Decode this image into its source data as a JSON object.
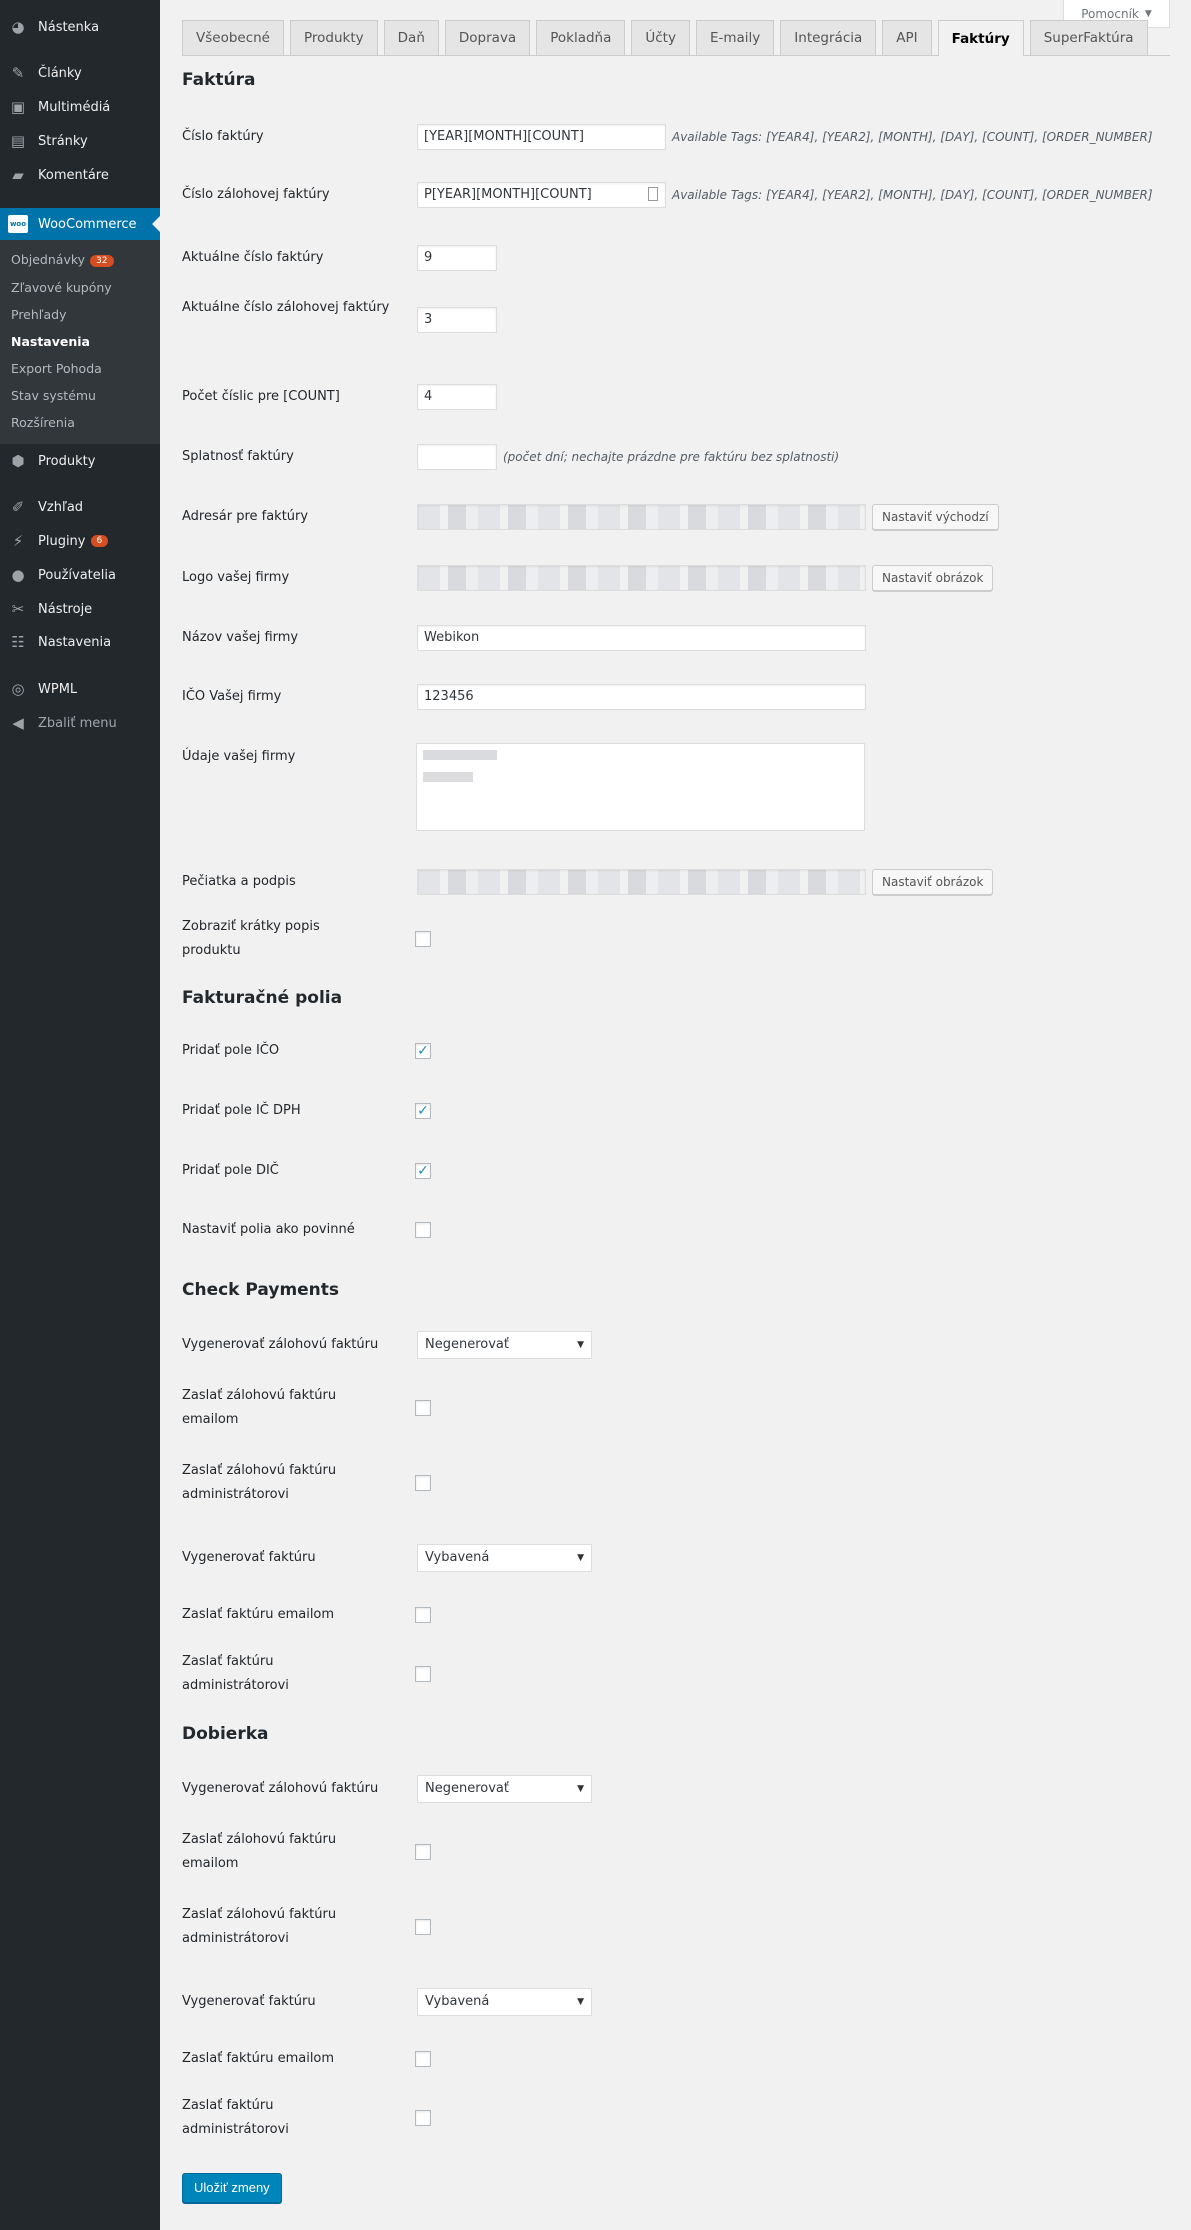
{
  "sidebar": {
    "items": [
      {
        "label": "Nástenka",
        "icon": "dashboard-icon"
      },
      {
        "label": "Články",
        "icon": "pin-icon"
      },
      {
        "label": "Multimédiá",
        "icon": "media-icon"
      },
      {
        "label": "Stránky",
        "icon": "pages-icon"
      },
      {
        "label": "Komentáre",
        "icon": "comment-icon"
      },
      {
        "label": "WooCommerce",
        "icon": "woo-icon",
        "icon_text": "woo"
      },
      {
        "label": "Produkty",
        "icon": "box-icon"
      },
      {
        "label": "Vzhľad",
        "icon": "brush-icon"
      },
      {
        "label": "Pluginy",
        "icon": "plugin-icon",
        "badge": "6"
      },
      {
        "label": "Používatelia",
        "icon": "user-icon"
      },
      {
        "label": "Nástroje",
        "icon": "wrench-icon"
      },
      {
        "label": "Nastavenia",
        "icon": "settings-icon"
      },
      {
        "label": "WPML",
        "icon": "wpml-icon"
      },
      {
        "label": "Zbaliť menu",
        "icon": "collapse-icon"
      }
    ],
    "submenu": [
      {
        "label": "Objednávky",
        "badge": "32"
      },
      {
        "label": "Zľavové kupóny"
      },
      {
        "label": "Prehľady"
      },
      {
        "label": "Nastavenia",
        "current": true
      },
      {
        "label": "Export Pohoda"
      },
      {
        "label": "Stav systému"
      },
      {
        "label": "Rozšírenia"
      }
    ]
  },
  "help_label": "Pomocník",
  "tabs": [
    "Všeobecné",
    "Produkty",
    "Daň",
    "Doprava",
    "Pokladňa",
    "Účty",
    "E-maily",
    "Integrácia",
    "API",
    "Faktúry",
    "SuperFaktúra"
  ],
  "active_tab": "Faktúry",
  "sections": [
    {
      "title": "Faktúra",
      "rows": [
        {
          "label": "Číslo faktúry",
          "type": "text",
          "value": "[YEAR][MONTH][COUNT]",
          "desc": "Available Tags: [YEAR4], [YEAR2], [MONTH], [DAY], [COUNT], [ORDER_NUMBER]"
        },
        {
          "label": "Číslo zálohovej faktúry",
          "type": "text",
          "value": "P[YEAR][MONTH][COUNT]",
          "desc": "Available Tags: [YEAR4], [YEAR2], [MONTH], [DAY], [COUNT], [ORDER_NUMBER]"
        },
        {
          "label": "Aktuálne číslo faktúry",
          "type": "num",
          "value": "9"
        },
        {
          "label": "Aktuálne číslo zálohovej faktúry",
          "type": "num",
          "value": "3"
        },
        {
          "label": "Počet číslic pre [COUNT]",
          "type": "num",
          "value": "4"
        },
        {
          "label": "Splatnosť faktúry",
          "type": "num",
          "value": "",
          "desc": "(počet dní; nechajte prázdne pre faktúru bez splatnosti)"
        },
        {
          "label": "Adresár pre faktúry",
          "type": "media",
          "button": "Nastaviť východzí"
        },
        {
          "label": "Logo vašej firmy",
          "type": "media",
          "button": "Nastaviť obrázok"
        },
        {
          "label": "Názov vašej firmy",
          "type": "wide",
          "value": "Webikon"
        },
        {
          "label": "IČO Vašej firmy",
          "type": "wide",
          "value": "123456"
        },
        {
          "label": "Údaje vašej firmy",
          "type": "textarea"
        },
        {
          "label": "Pečiatka a podpis",
          "type": "media",
          "button": "Nastaviť obrázok"
        },
        {
          "label": "Zobraziť krátky popis produktu",
          "type": "checkbox",
          "checked": false
        }
      ]
    },
    {
      "title": "Fakturačné polia",
      "rows": [
        {
          "label": "Pridať pole IČO",
          "type": "checkbox",
          "checked": true
        },
        {
          "label": "Pridať pole IČ DPH",
          "type": "checkbox",
          "checked": true
        },
        {
          "label": "Pridať pole DIČ",
          "type": "checkbox",
          "checked": true
        },
        {
          "label": "Nastaviť polia ako povinné",
          "type": "checkbox",
          "checked": false
        }
      ]
    },
    {
      "title": "Check Payments",
      "rows": [
        {
          "label": "Vygenerovať zálohovú faktúru",
          "type": "select",
          "value": "Negenerovať"
        },
        {
          "label": "Zaslať zálohovú faktúru emailom",
          "type": "checkbox",
          "checked": false
        },
        {
          "label": "Zaslať zálohovú faktúru administrátorovi",
          "type": "checkbox",
          "checked": false
        },
        {
          "label": "Vygenerovať faktúru",
          "type": "select",
          "value": "Vybavená"
        },
        {
          "label": "Zaslať faktúru emailom",
          "type": "checkbox",
          "checked": false
        },
        {
          "label": "Zaslať faktúru administrátorovi",
          "type": "checkbox",
          "checked": false
        }
      ]
    },
    {
      "title": "Dobierka",
      "rows": [
        {
          "label": "Vygenerovať zálohovú faktúru",
          "type": "select",
          "value": "Negenerovať"
        },
        {
          "label": "Zaslať zálohovú faktúru emailom",
          "type": "checkbox",
          "checked": false
        },
        {
          "label": "Zaslať zálohovú faktúru administrátorovi",
          "type": "checkbox",
          "checked": false
        },
        {
          "label": "Vygenerovať faktúru",
          "type": "select",
          "value": "Vybavená"
        },
        {
          "label": "Zaslať faktúru emailom",
          "type": "checkbox",
          "checked": false
        },
        {
          "label": "Zaslať faktúru administrátorovi",
          "type": "checkbox",
          "checked": false
        }
      ]
    }
  ],
  "save_label": "Uložiť zmeny"
}
